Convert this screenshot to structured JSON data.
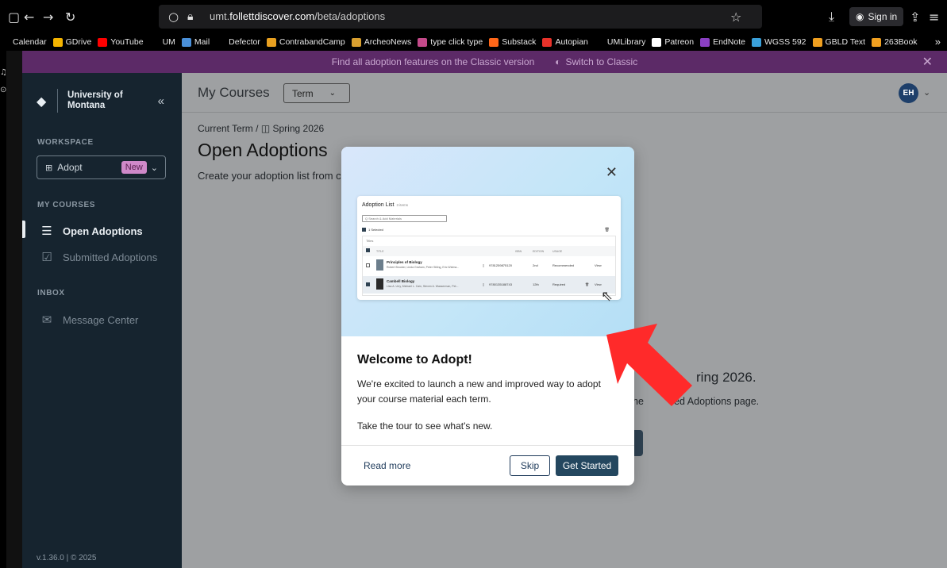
{
  "browser": {
    "url_prefix": "umt.",
    "url_domain": "follettdiscover.com",
    "url_path": "/beta/adoptions",
    "signin_label": "Sign in",
    "bookmarks": [
      {
        "label": "Calendar",
        "color": "#000000"
      },
      {
        "label": "GDrive",
        "color": "#f4b400"
      },
      {
        "label": "YouTube",
        "color": "#ff0000"
      },
      {
        "label": "UM",
        "color": "#000000"
      },
      {
        "label": "Mail",
        "color": "#4a90d9"
      },
      {
        "label": "Defector",
        "color": "#000000"
      },
      {
        "label": "ContrabandCamp",
        "color": "#e8a020"
      },
      {
        "label": "ArcheoNews",
        "color": "#d9a030"
      },
      {
        "label": "type click type",
        "color": "#c44a8a"
      },
      {
        "label": "Substack",
        "color": "#ff6719"
      },
      {
        "label": "Autopian",
        "color": "#e8322a"
      },
      {
        "label": "UMLibrary",
        "color": "#000000"
      },
      {
        "label": "Patreon",
        "color": "#ffffff"
      },
      {
        "label": "EndNote",
        "color": "#8a3fc2"
      },
      {
        "label": "WGSS 592",
        "color": "#3aa0d9"
      },
      {
        "label": "GBLD Text",
        "color": "#f0a020"
      },
      {
        "label": "263Book",
        "color": "#f0a020"
      }
    ]
  },
  "banner": {
    "message": "Find all adoption features on the Classic version",
    "switch_label": "Switch to Classic"
  },
  "sidebar": {
    "logo_line1": "University of",
    "logo_line2": "Montana",
    "workspace_heading": "WORKSPACE",
    "workspace_select": "Adopt",
    "workspace_badge": "New",
    "courses_heading": "MY COURSES",
    "nav_open": "Open Adoptions",
    "nav_submitted": "Submitted Adoptions",
    "inbox_heading": "INBOX",
    "nav_messages": "Message Center",
    "version": "v.1.36.0 | © 2025"
  },
  "header": {
    "title": "My Courses",
    "term_select": "Term",
    "avatar_initials": "EH"
  },
  "page": {
    "crumb_parent": "Current Term",
    "crumb_current": "Spring 2026",
    "title": "Open Adoptions",
    "subtitle": "Create your adoption list from c",
    "bg_heading": "ring 2026.",
    "bg_text": "he           ed Adoptions page."
  },
  "modal": {
    "title": "Welcome to Adopt!",
    "body": "We're excited to launch a new and improved way to adopt your course material each term.",
    "tour_text": "Take the tour to see what's new.",
    "read_more": "Read more",
    "skip": "Skip",
    "get_started": "Get Started",
    "preview": {
      "heading": "Adoption List",
      "count": "3 items",
      "search_placeholder": "Q Search & Add Materials",
      "selected_text": "1 Selected",
      "table_label": "Titles",
      "col_title": "TITLE",
      "col_isbn": "ISBN",
      "col_edition": "EDITION",
      "col_usage": "USAGE",
      "rows": [
        {
          "title": "Principles of Biology",
          "authors": "Robert Brooker, Linda Graham, Peter Stiling, Eric Widma...",
          "isbn": "9781259875120",
          "edition": "2nd",
          "usage": "Recommended",
          "action": "View"
        },
        {
          "title": "Cambell Biology",
          "authors": "Lisa A. Urry, Michael L. Cain, Steven A. Wasserman, Pet...",
          "isbn": "9780135188743",
          "edition": "12th",
          "usage": "Required",
          "action": "View"
        }
      ]
    }
  },
  "colors": {
    "banner": "#5c2a67",
    "sidebar": "#16242f",
    "primary_button": "#24475f",
    "arrow": "#ff2a2a"
  }
}
